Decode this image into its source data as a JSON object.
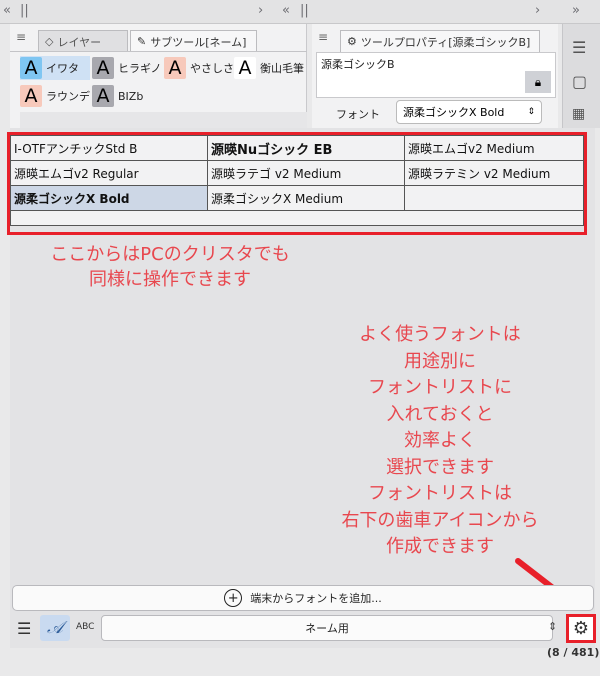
{
  "left_panel": {
    "tabs": [
      {
        "label": "レイヤー",
        "icon": "layers-icon"
      },
      {
        "label": "サブツール[ネーム]",
        "icon": "brush-icon"
      }
    ],
    "fonts": [
      {
        "glyph": "A",
        "label": "イワタ"
      },
      {
        "glyph": "A",
        "label": "ヒラギノ"
      },
      {
        "glyph": "A",
        "label": "やさしさ"
      },
      {
        "glyph": "A",
        "label": "衡山毛筆"
      },
      {
        "glyph": "A",
        "label": "ラウンデ"
      },
      {
        "glyph": "A",
        "label": "BIZb"
      }
    ]
  },
  "right_panel": {
    "tab_label": "ツールプロパティ[源柔ゴシックB]",
    "tool_name": "源柔ゴシックB",
    "font_label": "フォント",
    "font_value": "源柔ゴシックX Bold"
  },
  "font_list": {
    "rows": [
      [
        "I-OTFアンチックStd B",
        "源暎Nuゴシック EB",
        "源暎エムゴv2 Medium"
      ],
      [
        "源暎エムゴv2 Regular",
        "源暎ラテゴ v2 Medium",
        "源暎ラテミン v2 Medium"
      ],
      [
        "源柔ゴシックX Bold",
        "源柔ゴシックX Medium",
        ""
      ]
    ]
  },
  "annotations": {
    "top_lines": [
      "ここからはPCのクリスタでも",
      "同様に操作できます"
    ],
    "bottom_lines": [
      "よく使うフォントは",
      "用途別に",
      "フォントリストに",
      "入れておくと",
      "効率よく",
      "選択できます",
      "フォントリストは",
      "右下の歯車アイコンから",
      "作成できます"
    ]
  },
  "bottom_bar": {
    "add_font_label": "端末からフォントを追加...",
    "abc_label": "ABC",
    "list_name": "ネーム用",
    "count": "(8 / 481)"
  },
  "colors": {
    "highlight": "#e8202a",
    "annotation_text": "#e8474e",
    "selected_cell": "#cdd7e6"
  }
}
